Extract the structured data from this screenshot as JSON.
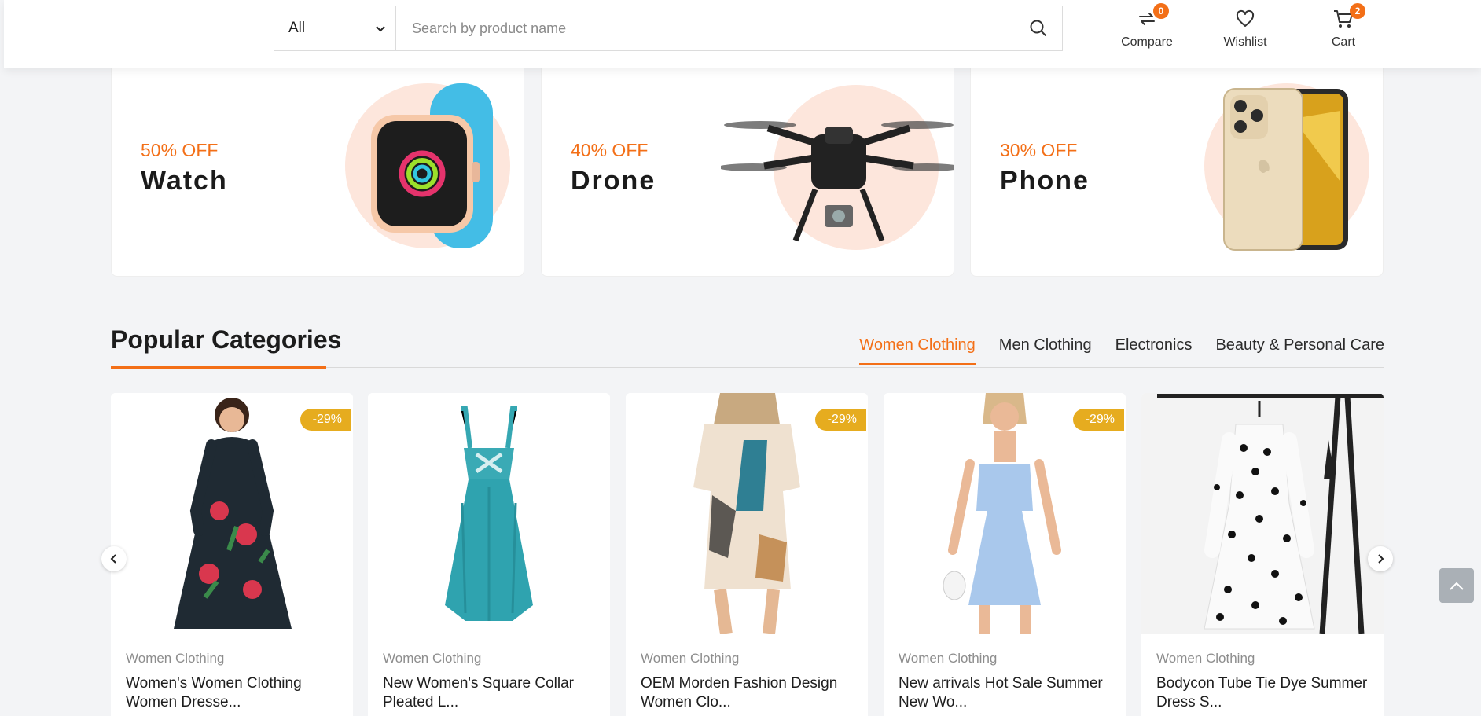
{
  "header": {
    "category_select": "All",
    "search_placeholder": "Search by product name",
    "compare": {
      "label": "Compare",
      "count": "0"
    },
    "wishlist": {
      "label": "Wishlist"
    },
    "cart": {
      "label": "Cart",
      "count": "2"
    }
  },
  "promos": [
    {
      "discount": "50% OFF",
      "name": "Watch"
    },
    {
      "discount": "40% OFF",
      "name": "Drone"
    },
    {
      "discount": "30% OFF",
      "name": "Phone"
    }
  ],
  "section": {
    "title": "Popular Categories",
    "tabs": [
      "Women Clothing",
      "Men Clothing",
      "Electronics",
      "Beauty & Personal Care"
    ],
    "active_tab": "Women Clothing"
  },
  "products": [
    {
      "category": "Women Clothing",
      "title": "Women's Women Clothing Women Dresse...",
      "discount": "-29%"
    },
    {
      "category": "Women Clothing",
      "title": "New Women's Square Collar Pleated L...",
      "discount": ""
    },
    {
      "category": "Women Clothing",
      "title": "OEM Morden Fashion Design Women Clo...",
      "discount": "-29%"
    },
    {
      "category": "Women Clothing",
      "title": "New arrivals Hot Sale Summer New Wo...",
      "discount": "-29%"
    },
    {
      "category": "Women Clothing",
      "title": "Bodycon Tube Tie Dye Summer Dress S...",
      "discount": ""
    }
  ],
  "colors": {
    "accent": "#f36f17",
    "badge": "#e6ac1f"
  },
  "icons": [
    "chevron-down-icon",
    "search-icon",
    "compare-icon",
    "heart-icon",
    "cart-icon",
    "chevron-left-icon",
    "chevron-right-icon",
    "arrow-up-icon"
  ]
}
